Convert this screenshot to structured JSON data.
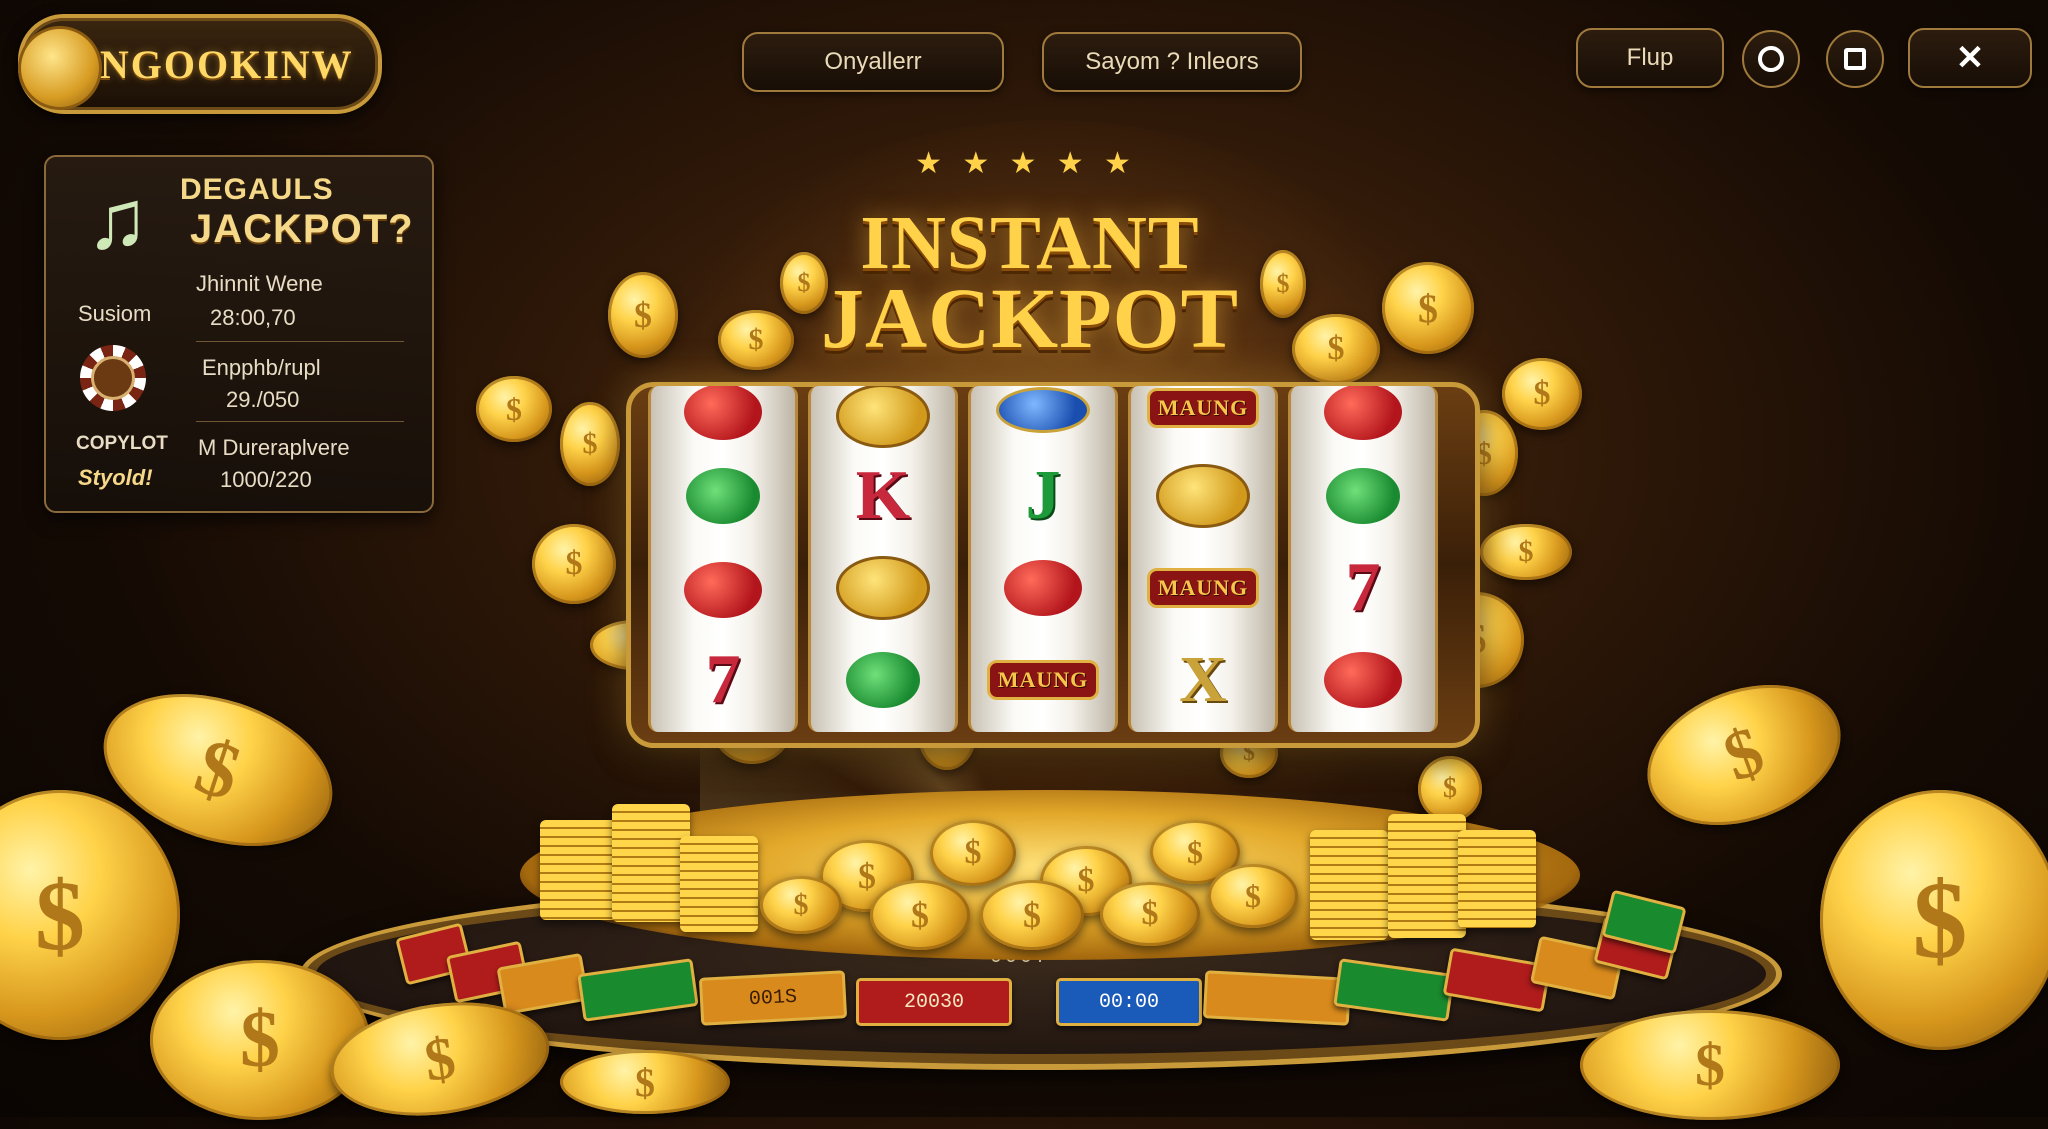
{
  "logo": {
    "text": "INGOOKINW"
  },
  "top_nav": {
    "buttons": [
      "Onyallerr",
      "Sayom ? Inleors",
      "Flup"
    ],
    "window_controls": [
      "circle-icon",
      "square-icon",
      "close-icon"
    ],
    "close_glyph": "✕"
  },
  "side_panel": {
    "heading_small": "DEGAULS",
    "heading_large": "JACKPOT?",
    "icon": "music-note-icon",
    "rows": [
      {
        "label": "Susiom",
        "title": "Jhinnit Wene",
        "value": "28:00,70"
      },
      {
        "label": "",
        "title": "Enpphb/rupl",
        "value": "29./050"
      },
      {
        "label": "COPYLOT",
        "label2": "Styold!",
        "title": "M Dureraplvere",
        "value": "1000/220"
      }
    ]
  },
  "title": {
    "line1": "INSTANT",
    "line2": "JACKPOT",
    "stars": "★ ★ ★ ★ ★"
  },
  "reels": [
    [
      "red-flower",
      "green-flower",
      "red-flower",
      "seven"
    ],
    [
      "gold-emblem",
      "K",
      "gold-emblem",
      "green-flower"
    ],
    [
      "blue-emblem",
      "J",
      "red-flower",
      "MAUNG"
    ],
    [
      "MAUNG",
      "gold-emblem",
      "MAUNG",
      "X"
    ],
    [
      "red-flower",
      "green-flower",
      "7",
      "red-flower"
    ]
  ],
  "reel_text": {
    "seven": "7",
    "k": "K",
    "j": "J",
    "x": "X",
    "badge": "MAUNG"
  },
  "table_tiles": [
    {
      "text": "",
      "color": "red"
    },
    {
      "text": "",
      "color": "red"
    },
    {
      "text": "",
      "color": "orange"
    },
    {
      "text": "",
      "color": "green"
    },
    {
      "text": "001S",
      "color": "orange"
    },
    {
      "text": "20030",
      "color": "red"
    },
    {
      "text": "00:00",
      "color": "blue"
    },
    {
      "text": "",
      "color": "orange"
    },
    {
      "text": "",
      "color": "green"
    },
    {
      "text": "",
      "color": "red"
    },
    {
      "text": "",
      "color": "orange"
    },
    {
      "text": "",
      "color": "red"
    },
    {
      "text": "",
      "color": "green"
    }
  ],
  "center_tile_text": "0007",
  "colors": {
    "gold": "#ffd24a",
    "panel_border": "#8a6a3a",
    "background": "#140a04"
  }
}
